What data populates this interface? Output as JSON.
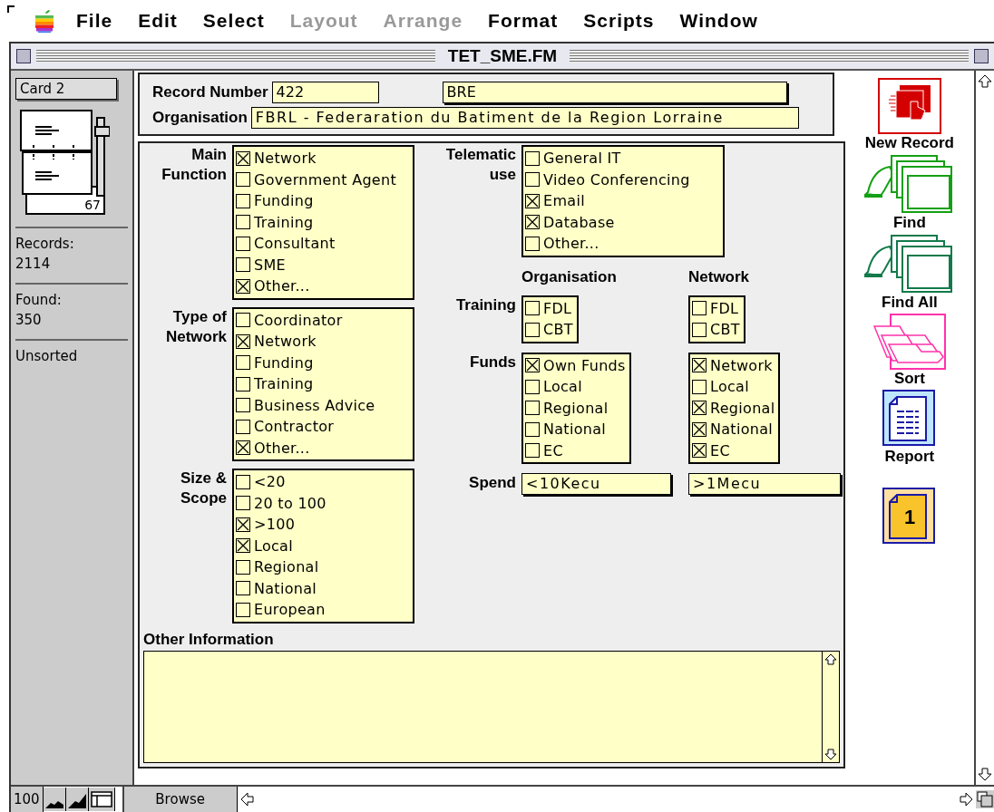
{
  "menu_bar": {
    "items": [
      {
        "label": "File",
        "disabled": false
      },
      {
        "label": "Edit",
        "disabled": false
      },
      {
        "label": "Select",
        "disabled": false
      },
      {
        "label": "Layout",
        "disabled": true
      },
      {
        "label": "Arrange",
        "disabled": true
      },
      {
        "label": "Format",
        "disabled": false
      },
      {
        "label": "Scripts",
        "disabled": false
      },
      {
        "label": "Window",
        "disabled": false
      }
    ]
  },
  "window": {
    "title": "TET_SME.FM"
  },
  "status_panel": {
    "layout": "Card 2",
    "page": "67",
    "records_label": "Records:",
    "records": "2114",
    "found_label": "Found:",
    "found": "350",
    "sort_state": "Unsorted"
  },
  "header": {
    "record_number_label": "Record Number",
    "record_number": "422",
    "code": "BRE",
    "organisation_label": "Organisation",
    "organisation": "FBRL - Federaration du Batiment de la Region Lorraine"
  },
  "left_groups": [
    {
      "label": "Main Function",
      "options": [
        {
          "label": "Network",
          "checked": true
        },
        {
          "label": "Government Agent",
          "checked": false
        },
        {
          "label": "Funding",
          "checked": false
        },
        {
          "label": "Training",
          "checked": false
        },
        {
          "label": "Consultant",
          "checked": false
        },
        {
          "label": "SME",
          "checked": false
        },
        {
          "label": "Other...",
          "checked": true
        }
      ]
    },
    {
      "label": "Type of Network",
      "options": [
        {
          "label": "Coordinator",
          "checked": false
        },
        {
          "label": "Network",
          "checked": true
        },
        {
          "label": "Funding",
          "checked": false
        },
        {
          "label": "Training",
          "checked": false
        },
        {
          "label": "Business Advice",
          "checked": false
        },
        {
          "label": "Contractor",
          "checked": false
        },
        {
          "label": "Other...",
          "checked": true
        }
      ]
    },
    {
      "label": "Size & Scope",
      "options": [
        {
          "label": "<20",
          "checked": false
        },
        {
          "label": "20 to 100",
          "checked": false
        },
        {
          "label": ">100",
          "checked": true
        },
        {
          "label": "Local",
          "checked": true
        },
        {
          "label": "Regional",
          "checked": false
        },
        {
          "label": "National",
          "checked": false
        },
        {
          "label": "European",
          "checked": false
        }
      ]
    }
  ],
  "telematic": {
    "label": "Telematic use",
    "options": [
      {
        "label": "General IT",
        "checked": false
      },
      {
        "label": "Video Conferencing",
        "checked": false
      },
      {
        "label": "Email",
        "checked": true
      },
      {
        "label": "Database",
        "checked": true
      },
      {
        "label": "Other...",
        "checked": false
      }
    ]
  },
  "columns": [
    "Organisation",
    "Network"
  ],
  "rows": [
    {
      "label": "Training",
      "organisation": [
        {
          "label": "FDL",
          "checked": false
        },
        {
          "label": "CBT",
          "checked": false
        }
      ],
      "network": [
        {
          "label": "FDL",
          "checked": false
        },
        {
          "label": "CBT",
          "checked": false
        }
      ]
    },
    {
      "label": "Funds",
      "organisation": [
        {
          "label": "Own Funds",
          "checked": true
        },
        {
          "label": "Local",
          "checked": false
        },
        {
          "label": "Regional",
          "checked": false
        },
        {
          "label": "National",
          "checked": false
        },
        {
          "label": "EC",
          "checked": false
        }
      ],
      "network": [
        {
          "label": "Network",
          "checked": true
        },
        {
          "label": "Local",
          "checked": false
        },
        {
          "label": "Regional",
          "checked": true
        },
        {
          "label": "National",
          "checked": true
        },
        {
          "label": "EC",
          "checked": true
        }
      ]
    }
  ],
  "spend": {
    "label": "Spend",
    "organisation": "<10Kecu",
    "network": ">1Mecu"
  },
  "other_information": {
    "label": "Other Information"
  },
  "toolbar": [
    {
      "label": "New Record",
      "kind": "new"
    },
    {
      "label": "Find",
      "kind": "find"
    },
    {
      "label": "Find All",
      "kind": "findall"
    },
    {
      "label": "Sort",
      "kind": "sort"
    },
    {
      "label": "Report",
      "kind": "report"
    },
    {
      "kind": "page",
      "number": "1"
    }
  ],
  "status_bar": {
    "zoom": "100",
    "mode": "Browse"
  }
}
